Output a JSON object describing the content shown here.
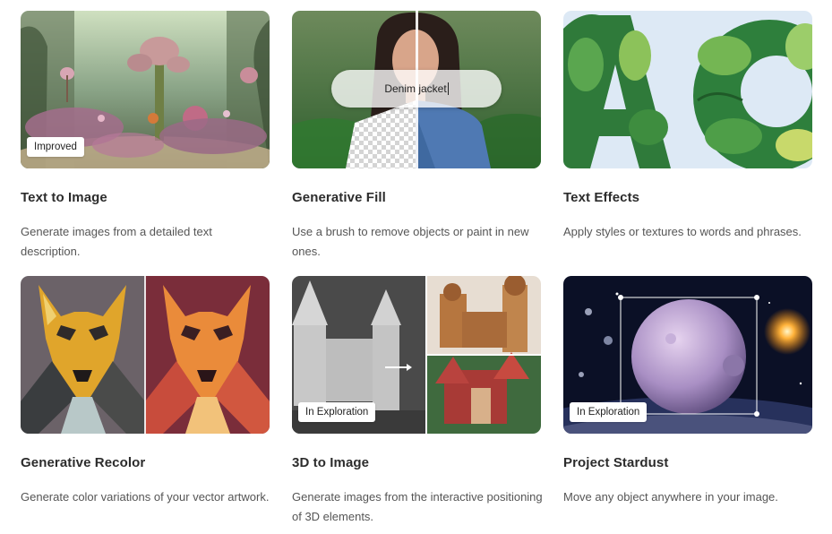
{
  "cards": [
    {
      "title": "Text to Image",
      "description": "Generate images from a detailed text description.",
      "badge": "Improved"
    },
    {
      "title": "Generative Fill",
      "description": "Use a brush to remove objects or paint in new ones.",
      "prompt": "Denim jacket"
    },
    {
      "title": "Text Effects",
      "description": "Apply styles or textures to words and phrases."
    },
    {
      "title": "Generative Recolor",
      "description": "Generate color variations of your vector artwork."
    },
    {
      "title": "3D to Image",
      "description": "Generate images from the interactive positioning of 3D elements.",
      "badge": "In Exploration"
    },
    {
      "title": "Project Stardust",
      "description": "Move any object anywhere in your image.",
      "badge": "In Exploration"
    }
  ]
}
